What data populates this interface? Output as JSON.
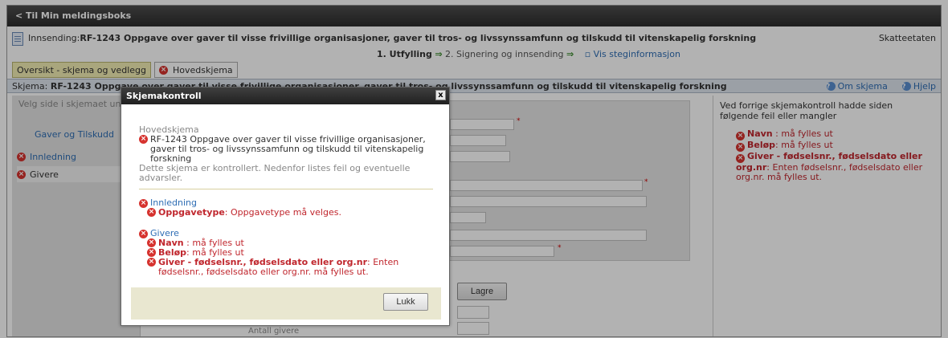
{
  "topbar": {
    "back_label": "< Til Min meldingsboks"
  },
  "header": {
    "innsending_prefix": "Innsending:",
    "innsending_title": "RF-1243 Oppgave over gaver til visse frivillige organisasjoner, gaver til tros- og livssynssamfunn og tilskudd til vitenskapelig forskning",
    "agency": "Skatteetaten"
  },
  "steps": {
    "step1": "1. Utfylling",
    "step2": "2. Signering og innsending",
    "info_link": "Vis steginformasjon"
  },
  "tabs": [
    {
      "label": "Oversikt - skjema og vedlegg"
    },
    {
      "label": "Hovedskjema"
    }
  ],
  "schema_bar": {
    "label": "Skjema:",
    "title": "RF-1243 Oppgave over gaver til visse frivillige organisasjoner, gaver til tros- og livssynssamfunn og tilskudd til vitenskapelig forskning",
    "om_label": "Om skjema",
    "help_label": "Hjelp"
  },
  "left_panel": {
    "hint": "Velg side i skjemaet under",
    "group": "Gaver og Tilskudd",
    "items": [
      {
        "label": "Innledning"
      },
      {
        "label": "Givere"
      }
    ]
  },
  "form": {
    "save_label": "Lagre",
    "antall_label": "Antall givere"
  },
  "right_panel": {
    "header": "Ved forrige skjemakontroll hadde siden følgende feil eller mangler",
    "errors": [
      {
        "field": "Navn",
        "text": " : må fylles ut"
      },
      {
        "field": "Beløp",
        "text": ": må fylles ut"
      },
      {
        "field": "Giver - fødselsnr., fødselsdato eller org.nr",
        "text": ": Enten fødselsnr., fødselsdato eller org.nr. må fylles ut."
      }
    ]
  },
  "dialog": {
    "title": "Skjemakontroll",
    "close_symbol": "x",
    "section_label": "Hovedskjema",
    "schema_title": "RF-1243 Oppgave over gaver til visse frivillige organisasjoner, gaver til tros- og livssynssamfunn og tilskudd til vitenskapelig forskning",
    "controlled_text": "Dette skjema er kontrollert. Nedenfor listes feil og eventuelle advarsler.",
    "innledning": {
      "head": "Innledning",
      "items": [
        {
          "field": "Oppgavetype",
          "text": ": Oppgavetype må velges."
        }
      ]
    },
    "givere": {
      "head": "Givere",
      "items": [
        {
          "field": "Navn",
          "text": " : må fylles ut"
        },
        {
          "field": "Beløp",
          "text": ": må fylles ut"
        },
        {
          "field": "Giver - fødselsnr., fødselsdato eller org.nr",
          "text": ": Enten fødselsnr., fødselsdato eller org.nr. må fylles ut."
        }
      ]
    },
    "close_label": "Lukk"
  },
  "colors": {
    "error": "#c0262d",
    "link": "#2e6db4",
    "tab_active": "#f3eeb4",
    "footer": "#e9e7d0"
  }
}
